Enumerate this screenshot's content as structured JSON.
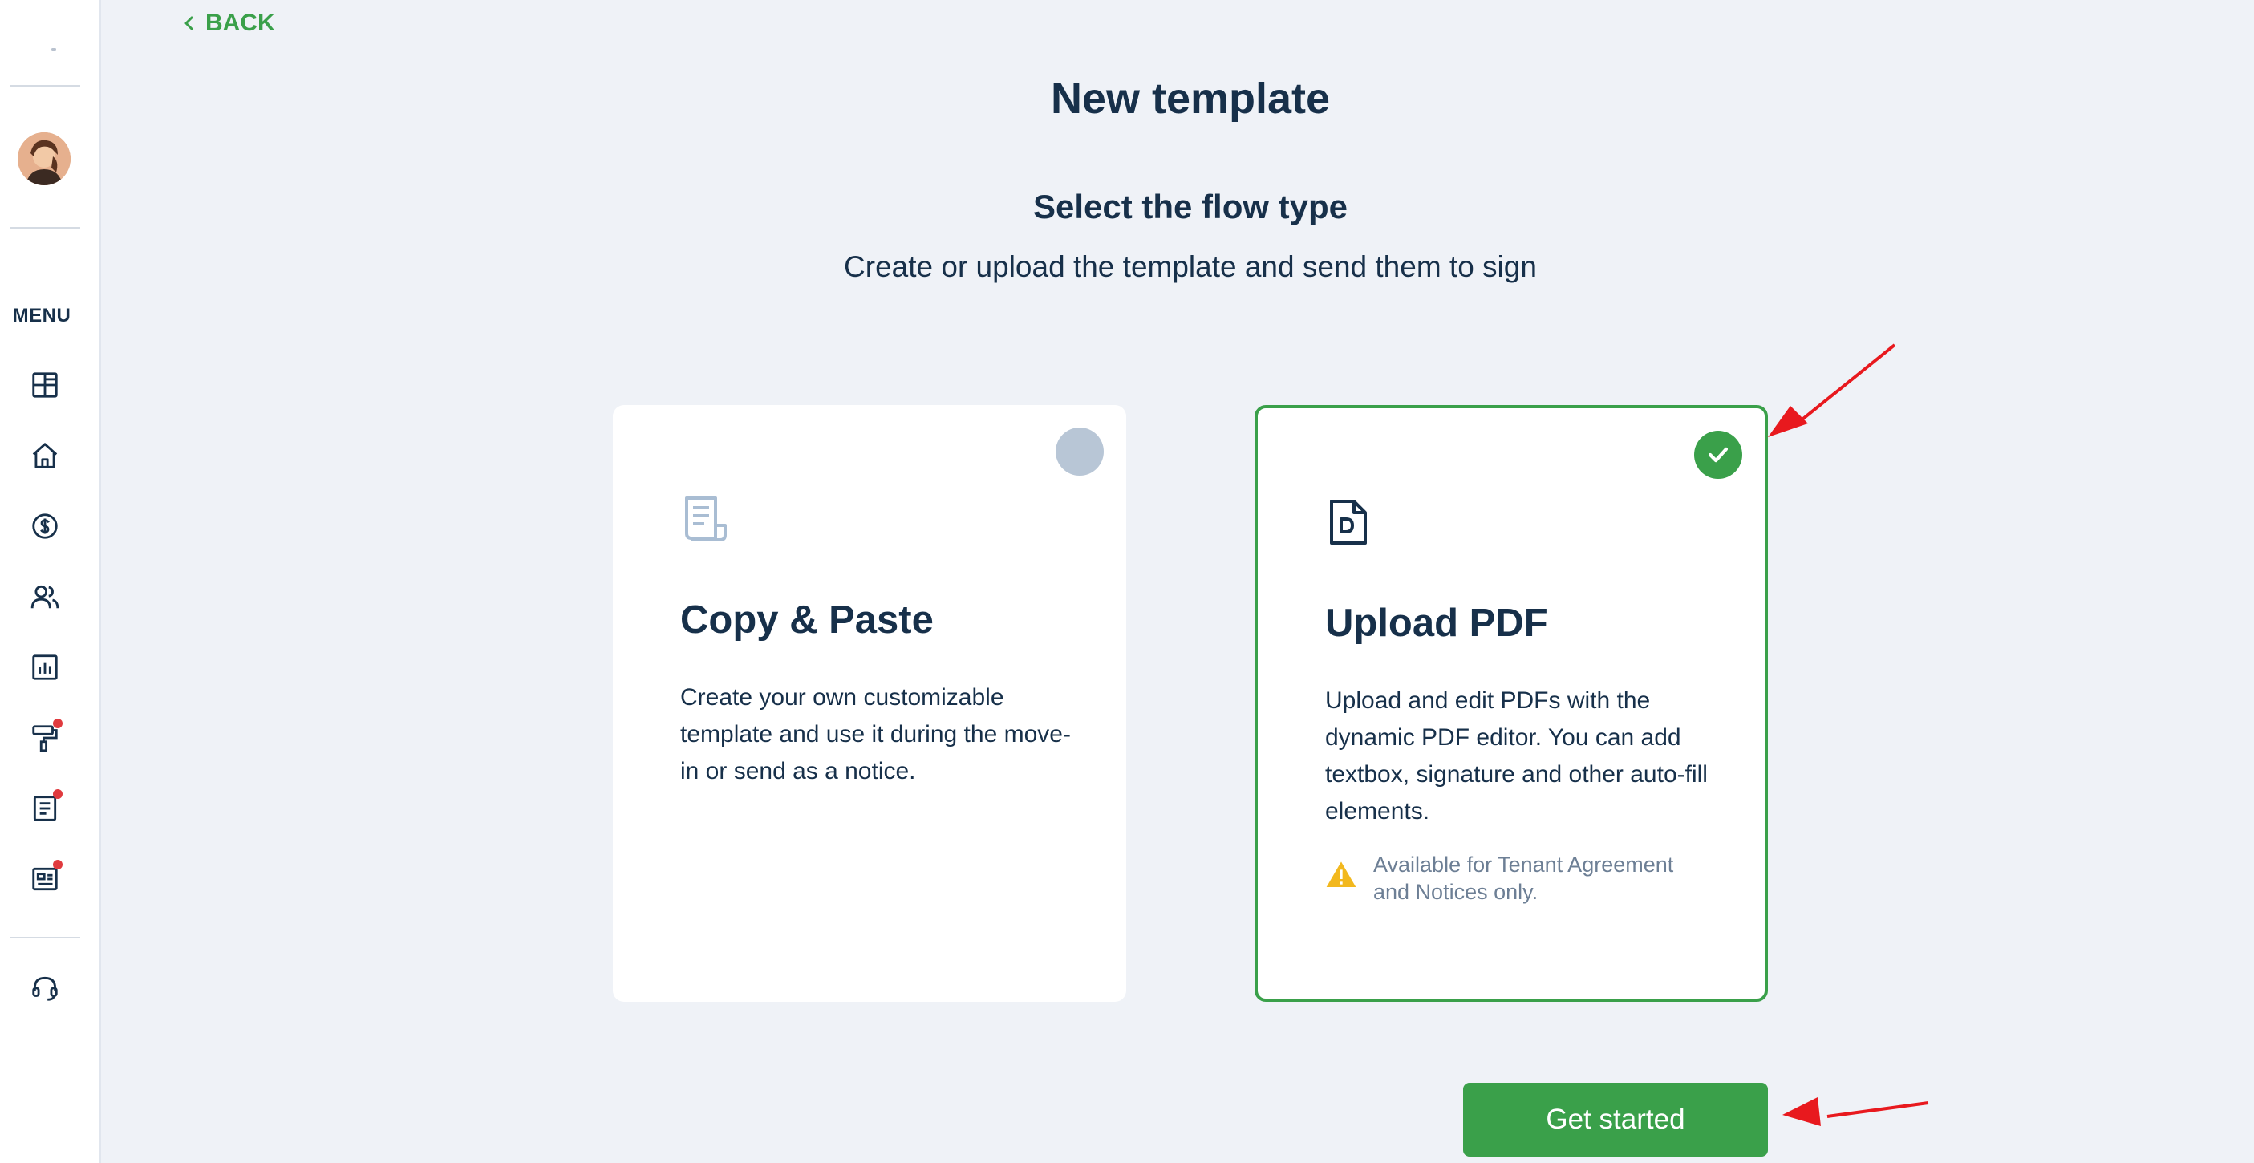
{
  "sidebar": {
    "menu_label": "MENU",
    "nav_items": [
      {
        "icon": "dashboard-icon",
        "has_badge": false
      },
      {
        "icon": "home-icon",
        "has_badge": false
      },
      {
        "icon": "dollar-icon",
        "has_badge": false
      },
      {
        "icon": "users-icon",
        "has_badge": false
      },
      {
        "icon": "reports-icon",
        "has_badge": false
      },
      {
        "icon": "paint-roller-icon",
        "has_badge": true
      },
      {
        "icon": "document-icon",
        "has_badge": true
      },
      {
        "icon": "listing-icon",
        "has_badge": true
      }
    ],
    "support_icon": "headset-icon"
  },
  "header": {
    "back_label": "BACK",
    "title": "New template"
  },
  "flow": {
    "title": "Select the flow type",
    "subtitle": "Create or upload the template and send them to sign"
  },
  "cards": [
    {
      "title": "Copy & Paste",
      "description": "Create your own customizable template and use it during the move-in or send as a notice.",
      "selected": false,
      "icon": "document-scroll-icon"
    },
    {
      "title": "Upload PDF",
      "description": "Upload and edit PDFs with the dynamic PDF editor. You can add textbox, signature and other auto-fill elements.",
      "note": "Available for Tenant Agreement and Notices only.",
      "selected": true,
      "icon": "pdf-file-icon"
    }
  ],
  "actions": {
    "get_started_label": "Get started"
  },
  "colors": {
    "accent": "#3aa04a",
    "text": "#17304a",
    "background": "#eff2f7",
    "badge": "#e03a3e",
    "annotation": "#e8191e"
  }
}
